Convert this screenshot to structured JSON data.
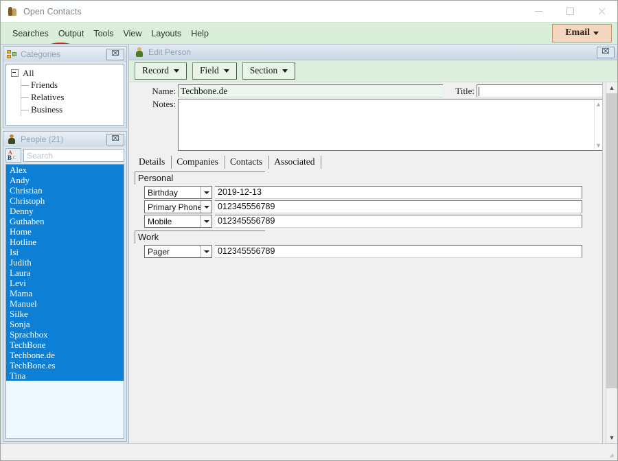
{
  "window": {
    "title": "Open Contacts",
    "icon": "contacts-app-icon",
    "controls": {
      "minimize": "–",
      "maximize": "□",
      "close": "✕"
    }
  },
  "menubar": {
    "items": [
      {
        "label": "Searches"
      },
      {
        "label": "Output"
      },
      {
        "label": "Tools"
      },
      {
        "label": "View"
      },
      {
        "label": "Layouts"
      },
      {
        "label": "Help"
      }
    ],
    "email_button": {
      "label": "Email"
    },
    "annotation": {
      "target": "Output",
      "color": "#d41f1f"
    }
  },
  "categories_panel": {
    "title": "Categories",
    "close_label": "⌧",
    "tree": {
      "root": "All",
      "children": [
        "Friends",
        "Relatives",
        "Business"
      ]
    }
  },
  "people_panel": {
    "title": "People",
    "count": "(21)",
    "close_label": "⌧",
    "search": {
      "placeholder": "Search",
      "value": ""
    },
    "sort_icon": {
      "a": "A",
      "b": "B",
      "c": "C"
    },
    "items": [
      "Alex",
      "Andy",
      "Christian",
      "Christoph",
      "Denny",
      "Guthaben",
      "Home",
      "Hotline",
      "Isi",
      "Judith",
      "Laura",
      "Levi",
      "Mama",
      "Manuel",
      "Silke",
      "Sonja",
      "Sprachbox",
      "TechBone",
      "Techbone.de",
      "TechBone.es",
      "Tina"
    ]
  },
  "edit_person": {
    "title": "Edit Person",
    "close_label": "⌧",
    "toolbar": [
      {
        "label": "Record"
      },
      {
        "label": "Field"
      },
      {
        "label": "Section"
      }
    ],
    "name": {
      "label": "Name:",
      "value": "Techbone.de"
    },
    "title_field": {
      "label": "Title:",
      "value": ""
    },
    "notes": {
      "label": "Notes:",
      "value": ""
    },
    "tabs": [
      {
        "label": "Details",
        "active": true
      },
      {
        "label": "Companies",
        "active": false
      },
      {
        "label": "Contacts",
        "active": false
      },
      {
        "label": "Associated",
        "active": false
      }
    ],
    "sections": [
      {
        "header": "Personal",
        "fields": [
          {
            "type": "Birthday",
            "value": "2019-12-13"
          },
          {
            "type": "Primary Phone",
            "value": "012345556789"
          },
          {
            "type": "Mobile",
            "value": "012345556789"
          }
        ]
      },
      {
        "header": "Work",
        "fields": [
          {
            "type": "Pager",
            "value": "012345556789"
          }
        ]
      }
    ],
    "scrollbar": {
      "up": "▲",
      "down": "▼"
    }
  },
  "status_bar": {
    "text": ""
  }
}
